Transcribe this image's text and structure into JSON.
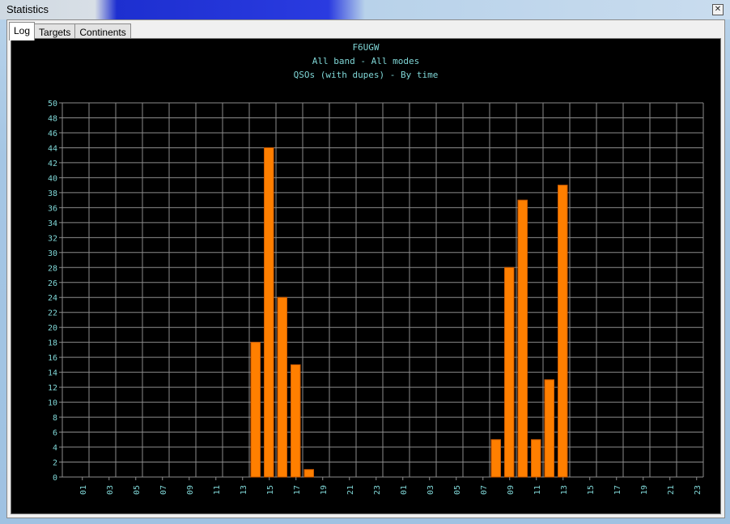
{
  "window": {
    "title": "Statistics",
    "close_glyph": "✕"
  },
  "tabs": [
    {
      "label": "Log",
      "active": true
    },
    {
      "label": "Targets",
      "active": false
    },
    {
      "label": "Continents",
      "active": false
    }
  ],
  "colors": {
    "bar": "#ff7f00",
    "bar_edge": "#cc5a00",
    "text": "#7fd6d6",
    "grid": "#8c8c8c",
    "background": "#000000"
  },
  "chart_data": {
    "type": "bar",
    "title": "F6UGW",
    "subtitle": "All band - All modes",
    "subtitle2": "QSOs (with dupes) - By time",
    "xlabel": "",
    "ylabel": "",
    "ylim": [
      0,
      50
    ],
    "y_tick_step": 2,
    "grid": true,
    "categories": [
      "00",
      "01",
      "02",
      "03",
      "04",
      "05",
      "06",
      "07",
      "08",
      "09",
      "10",
      "11",
      "12",
      "13",
      "14",
      "15",
      "16",
      "17",
      "18",
      "19",
      "20",
      "21",
      "22",
      "23",
      "00",
      "01",
      "02",
      "03",
      "04",
      "05",
      "06",
      "07",
      "08",
      "09",
      "10",
      "11",
      "12",
      "13",
      "14",
      "15",
      "16",
      "17",
      "18",
      "19",
      "20",
      "21",
      "22",
      "23"
    ],
    "x_tick_labels": [
      "01",
      "03",
      "05",
      "07",
      "09",
      "11",
      "13",
      "15",
      "17",
      "19",
      "21",
      "23",
      "01",
      "03",
      "05",
      "07",
      "09",
      "11",
      "13",
      "15",
      "17",
      "19",
      "21",
      "23"
    ],
    "values": [
      0,
      0,
      0,
      0,
      0,
      0,
      0,
      0,
      0,
      0,
      0,
      0,
      0,
      0,
      18,
      44,
      24,
      15,
      1,
      0,
      0,
      0,
      0,
      0,
      0,
      0,
      0,
      0,
      0,
      0,
      0,
      0,
      5,
      28,
      37,
      5,
      13,
      39,
      0,
      0,
      0,
      0,
      0,
      0,
      0,
      0,
      0,
      0
    ]
  }
}
